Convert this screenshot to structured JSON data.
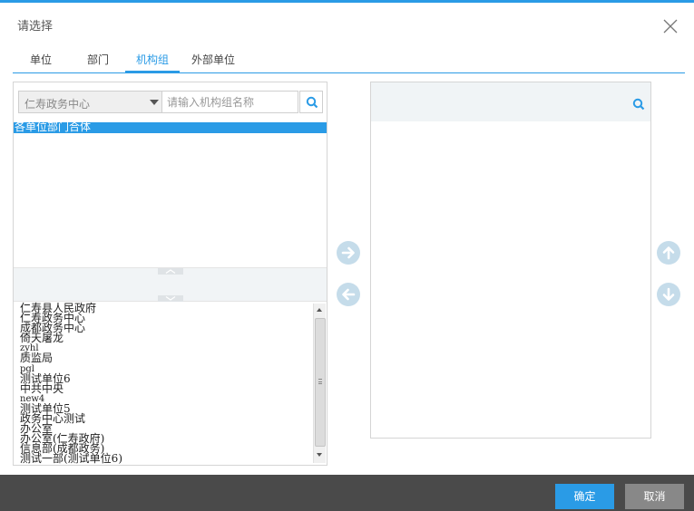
{
  "dialog": {
    "title": "请选择",
    "close_icon": "close-icon"
  },
  "tabs": [
    {
      "label": "单位",
      "active": false
    },
    {
      "label": "部门",
      "active": false
    },
    {
      "label": "机构组",
      "active": true
    },
    {
      "label": "外部单位",
      "active": false
    }
  ],
  "left": {
    "select_value": "仁寿政务中心",
    "search_placeholder": "请输入机构组名称",
    "groups": [
      "各单位部门合体"
    ],
    "units": [
      "仁寿县人民政府",
      "仁寿政务中心",
      "成都政务中心",
      "倚天屠龙",
      "zyhl",
      "质监局",
      "pgl",
      "测试单位6",
      "中共中央",
      "new4",
      "测试单位5",
      "政务中心测试",
      "办公室",
      "办公室(仁寿政府)",
      "信息部(成都政务)",
      "测试一部(测试单位6)"
    ]
  },
  "footer": {
    "ok_label": "确定",
    "cancel_label": "取消"
  },
  "colors": {
    "accent": "#2a9be6",
    "footer_bg": "#4a4a4a",
    "round_button": "#c5dcea"
  }
}
